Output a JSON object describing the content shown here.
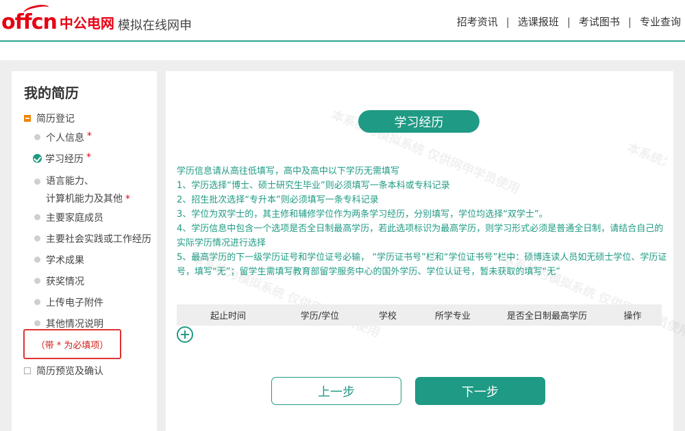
{
  "header": {
    "logo_text": "offcn",
    "logo_cn": "中公电网",
    "site_subtitle": "模拟在线网申",
    "nav": [
      {
        "label": "招考资讯"
      },
      {
        "label": "选课报班"
      },
      {
        "label": "考试图书"
      },
      {
        "label": "专业查询"
      }
    ],
    "nav_separator": "|"
  },
  "sidebar": {
    "title": "我的简历",
    "section_register": "简历登记",
    "items": [
      {
        "label": "个人信息",
        "required": "*",
        "status": "pending"
      },
      {
        "label": "学习经历",
        "required": "*",
        "status": "done"
      },
      {
        "label_line1": "语言能力、",
        "label_line2": "计算机能力及其他",
        "required": "*",
        "status": "pending"
      },
      {
        "label": "主要家庭成员",
        "status": "pending"
      },
      {
        "label": "主要社会实践或工作经历",
        "status": "pending"
      },
      {
        "label": "学术成果",
        "status": "pending"
      },
      {
        "label": "获奖情况",
        "status": "pending"
      },
      {
        "label": "上传电子附件",
        "status": "pending"
      },
      {
        "label": "其他情况说明",
        "status": "pending"
      }
    ],
    "required_note": "（带 * 为必填项）",
    "section_preview": "简历预览及确认"
  },
  "main": {
    "section_title": "学习经历",
    "notes": [
      "学历信息请从高往低填写，高中及高中以下学历无需填写",
      "1、学历选择“博士、硕士研究生毕业”则必须填写一条本科或专科记录",
      "2、招生批次选择“专升本”则必须填写一条专科记录",
      "3、学位为双学士的，其主修和辅修学位作为两条学习经历，分别填写，学位均选择“双学士”。",
      "4、学历信息中包含一个选项是否全日制最高学历，若此选项标识为最高学历，则学习形式必须是普通全日制，请结合自己的实际学历情况进行选择",
      "5、最高学历的下一级学历证号和学位证号必输， “学历证书号”栏和“学位证书号”栏中：硕博连读人员如无硕士学位、学历证号，填写“无”；留学生需填写教育部留学服务中心的国外学历、学位认证号，暂未获取的填写“无”"
    ],
    "table": {
      "columns": [
        "起止时间",
        "学历/学位",
        "学校",
        "所学专业",
        "是否全日制最高学历",
        "操作"
      ]
    },
    "watermark": "本系统为模拟系统 仅供网申学员使用",
    "prev_label": "上一步",
    "next_label": "下一步"
  },
  "colors": {
    "accent": "#1f9a84",
    "brand_red": "#e60012",
    "required_red": "#e03030"
  }
}
